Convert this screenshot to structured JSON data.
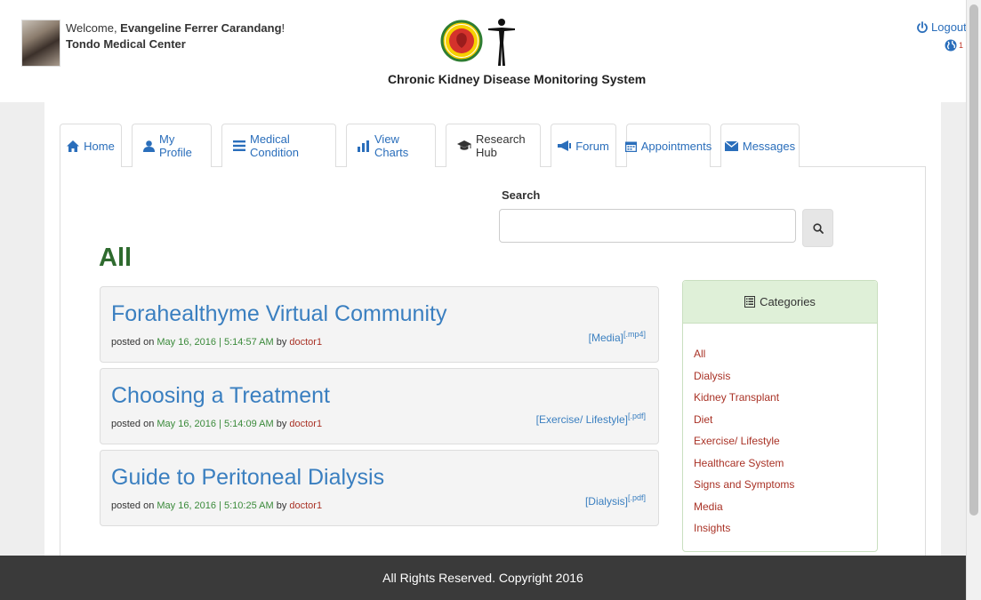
{
  "header": {
    "welcome_prefix": "Welcome, ",
    "user_name": "Evangeline Ferrer Carandang",
    "welcome_suffix": "!",
    "hospital": "Tondo Medical Center",
    "site_title": "Chronic Kidney Disease Monitoring System",
    "logout_label": "Logout",
    "notification_count": "1"
  },
  "tabs": [
    {
      "label": "Home",
      "icon": "home-icon"
    },
    {
      "label": "My Profile",
      "icon": "user-icon"
    },
    {
      "label": "Medical Condition",
      "icon": "list-icon"
    },
    {
      "label": "View Charts",
      "icon": "bar-chart-icon"
    },
    {
      "label": "Research Hub",
      "icon": "graduation-cap-icon"
    },
    {
      "label": "Forum",
      "icon": "bullhorn-icon"
    },
    {
      "label": "Appointments",
      "icon": "calendar-icon"
    },
    {
      "label": "Messages",
      "icon": "envelope-icon"
    }
  ],
  "active_tab": "Research Hub",
  "search": {
    "label": "Search",
    "value": "",
    "placeholder": ""
  },
  "section_heading": "All",
  "posts": [
    {
      "title": "Forahealthyme Virtual Community",
      "posted_prefix": "posted on ",
      "date": "May 16, 2016 | 5:14:57 AM",
      "by": " by ",
      "author": "doctor1",
      "category": "[Media]",
      "filetype": "[.mp4]"
    },
    {
      "title": "Choosing a Treatment",
      "posted_prefix": "posted on ",
      "date": "May 16, 2016 | 5:14:09 AM",
      "by": " by ",
      "author": "doctor1",
      "category": "[Exercise/ Lifestyle]",
      "filetype": "[.pdf]"
    },
    {
      "title": "Guide to Peritoneal Dialysis",
      "posted_prefix": "posted on ",
      "date": "May 16, 2016 | 5:10:25 AM",
      "by": " by ",
      "author": "doctor1",
      "category": "[Dialysis]",
      "filetype": "[.pdf]"
    }
  ],
  "categories": {
    "title": "Categories",
    "items": [
      "All",
      "Dialysis",
      "Kidney Transplant",
      "Diet",
      "Exercise/ Lifestyle",
      "Healthcare System",
      "Signs and Symptoms",
      "Media",
      "Insights"
    ]
  },
  "footer": {
    "text": "All Rights Reserved. Copyright 2016"
  },
  "colors": {
    "link_blue": "#3a7fc0",
    "heading_green": "#2f6b2f",
    "date_green": "#3a8a3a",
    "author_red": "#a93226",
    "category_header_bg": "#dff0d8",
    "footer_bg": "#3a3a3a"
  }
}
